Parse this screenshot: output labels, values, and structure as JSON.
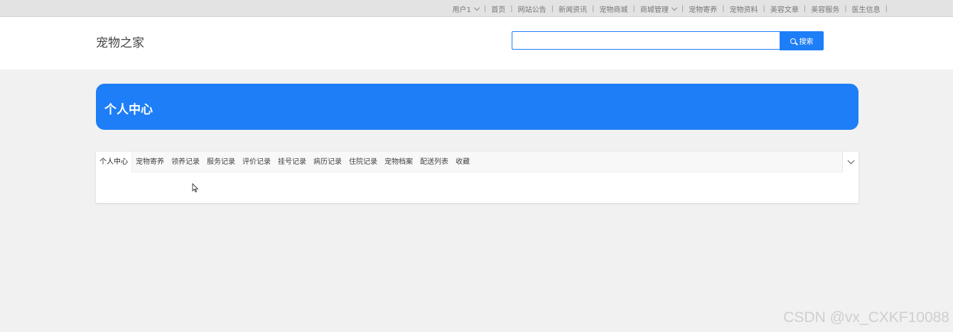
{
  "topnav": {
    "user": "用户1",
    "items": [
      "首页",
      "网站公告",
      "新闻资讯",
      "宠物商城",
      "商城管理",
      "宠物寄养",
      "宠物资料",
      "美容文章",
      "美容服务",
      "医生信息"
    ]
  },
  "header": {
    "logo": "宠物之家",
    "search_placeholder": "",
    "search_button": "搜索"
  },
  "banner": {
    "title": "个人中心"
  },
  "tabs": [
    "个人中心",
    "宠物寄养",
    "领养记录",
    "服务记录",
    "评价记录",
    "挂号记录",
    "病历记录",
    "住院记录",
    "宠物档案",
    "配送列表",
    "收藏"
  ],
  "watermark": "CSDN @vx_CXKF10088",
  "colors": {
    "accent": "#1e7ef7",
    "background": "#f1f1f1",
    "topbar": "#e3e3e3"
  }
}
